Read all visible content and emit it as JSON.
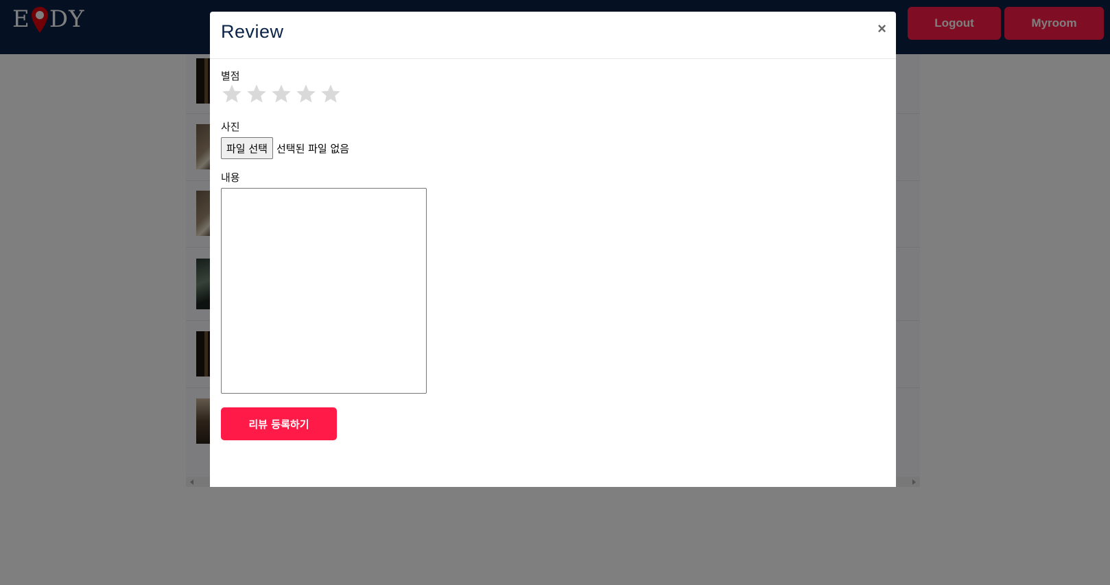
{
  "navbar": {
    "logo_left": "E",
    "logo_right": "DY",
    "buttons": [
      {
        "label": "Logout"
      },
      {
        "label": "Myroom"
      }
    ]
  },
  "modal": {
    "title": "Review",
    "close_symbol": "×",
    "rating": {
      "label": "별점",
      "max_stars": 5,
      "selected": 0,
      "star_color": "#d9d9d9"
    },
    "photo": {
      "label": "사진",
      "button_label": "파일 선택",
      "status_text": "선택된 파일 없음"
    },
    "content": {
      "label": "내용",
      "value": ""
    },
    "submit_label": "리뷰 등록하기"
  },
  "colors": {
    "navbar_bg": "#0b2347",
    "accent": "#ff1a47",
    "backdrop": "rgba(0,0,0,0.5)"
  }
}
